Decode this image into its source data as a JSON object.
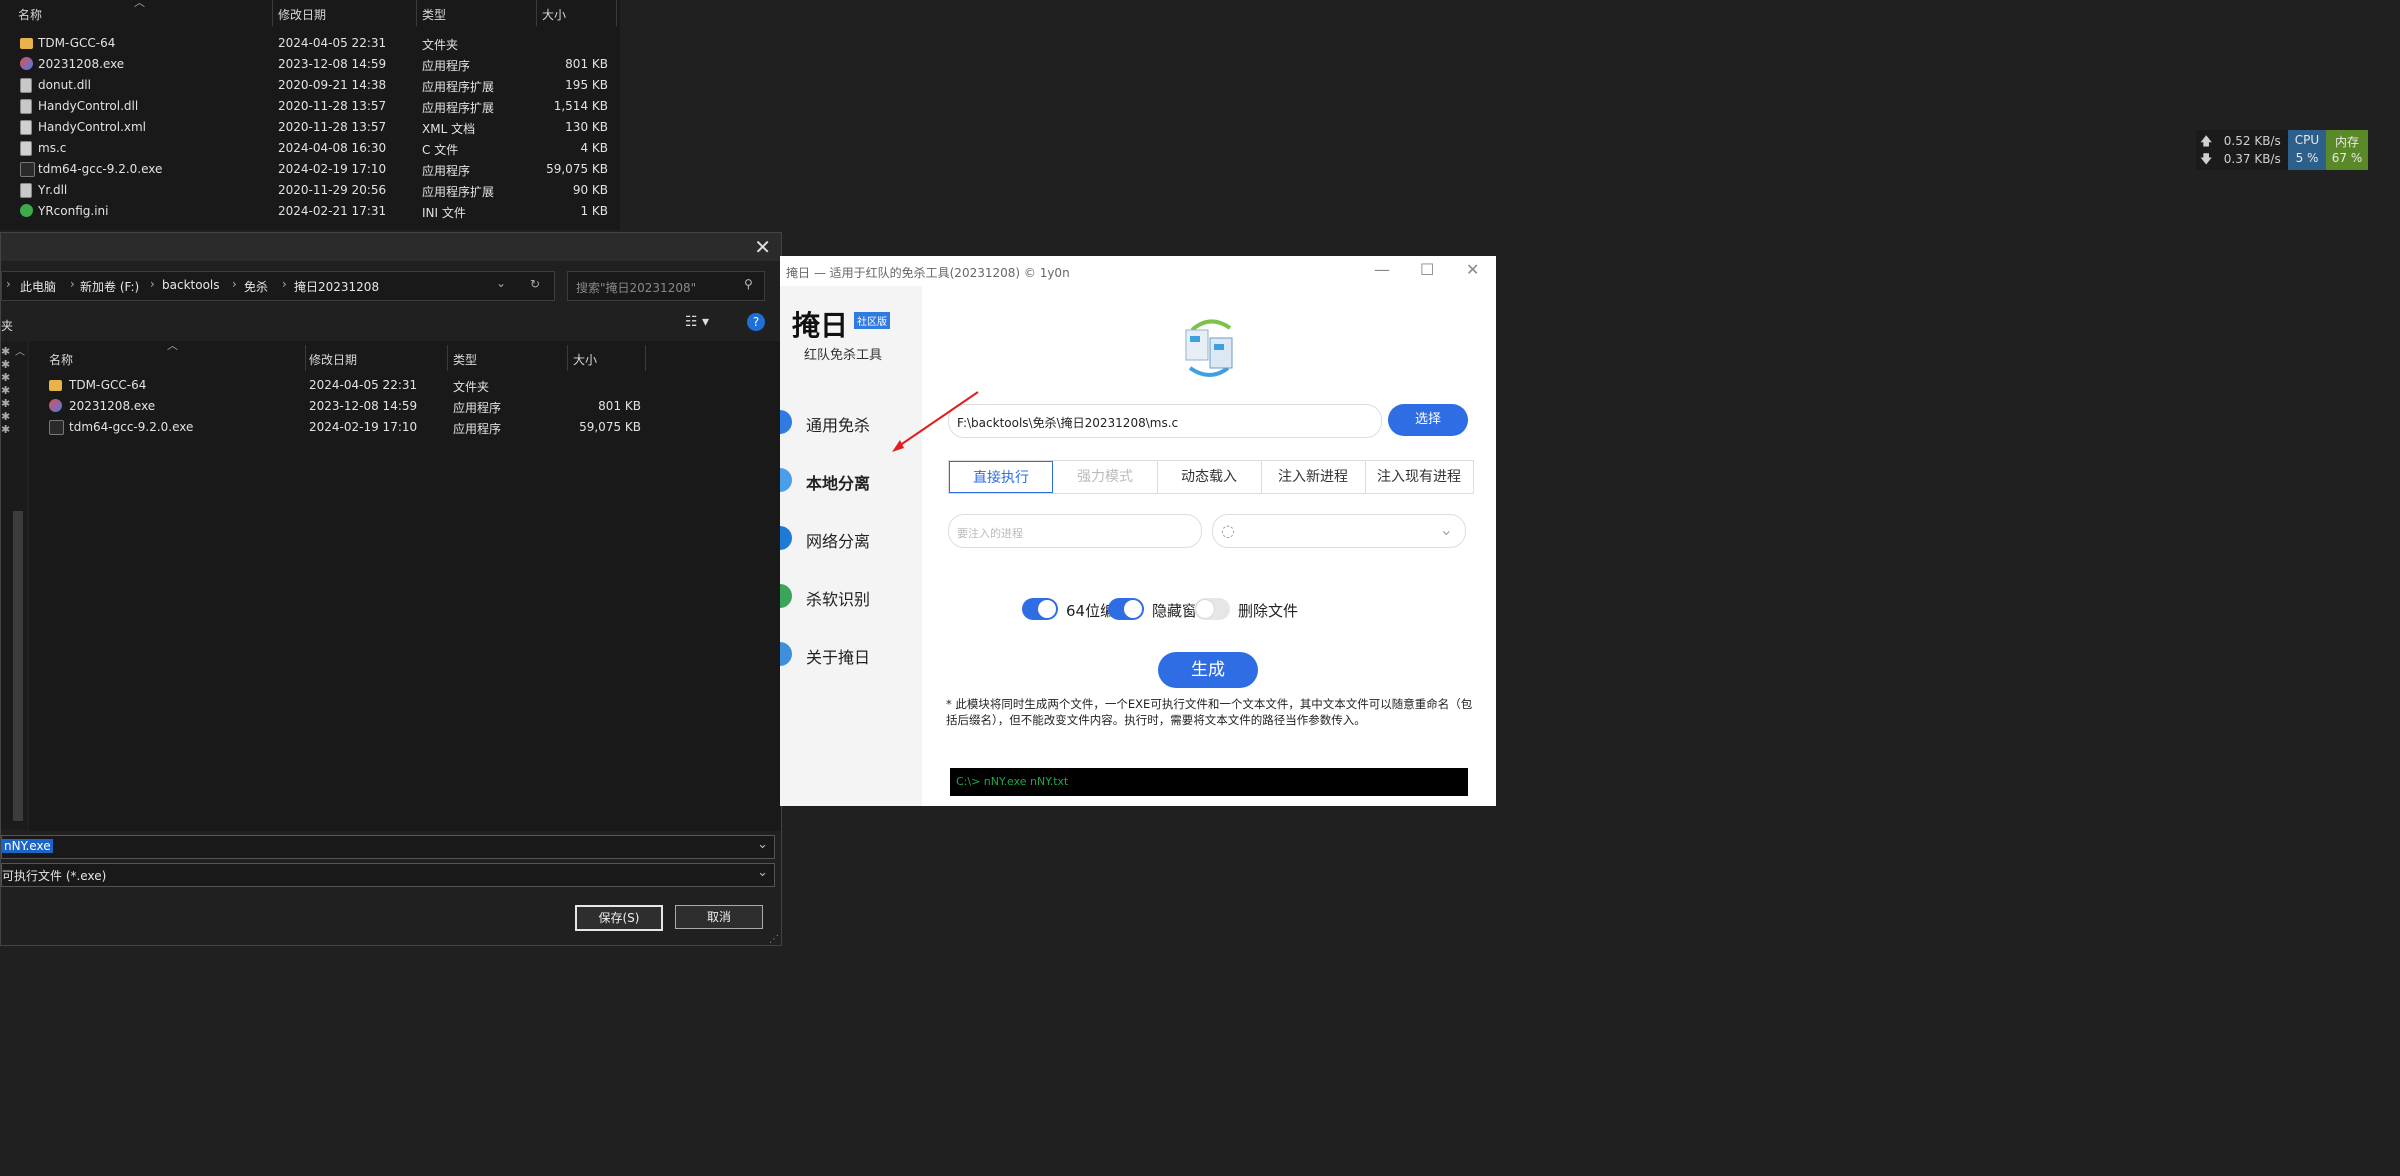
{
  "background_explorer": {
    "columns": [
      "名称",
      "修改日期",
      "类型",
      "大小"
    ],
    "rows": [
      {
        "icon": "folder-icon",
        "name": "TDM-GCC-64",
        "date": "2024-04-05 22:31",
        "type": "文件夹",
        "size": ""
      },
      {
        "icon": "exe-icon",
        "name": "20231208.exe",
        "date": "2023-12-08 14:59",
        "type": "应用程序",
        "size": "801 KB"
      },
      {
        "icon": "dll-icon",
        "name": "donut.dll",
        "date": "2020-09-21 14:38",
        "type": "应用程序扩展",
        "size": "195 KB"
      },
      {
        "icon": "dll-icon",
        "name": "HandyControl.dll",
        "date": "2020-11-28 13:57",
        "type": "应用程序扩展",
        "size": "1,514 KB"
      },
      {
        "icon": "xml-icon",
        "name": "HandyControl.xml",
        "date": "2020-11-28 13:57",
        "type": "XML 文档",
        "size": "130 KB"
      },
      {
        "icon": "c-file-icon",
        "name": "ms.c",
        "date": "2024-04-08 16:30",
        "type": "C 文件",
        "size": "4 KB"
      },
      {
        "icon": "gcc-icon",
        "name": "tdm64-gcc-9.2.0.exe",
        "date": "2024-02-19 17:10",
        "type": "应用程序",
        "size": "59,075 KB"
      },
      {
        "icon": "dll-icon",
        "name": "Yr.dll",
        "date": "2020-11-29 20:56",
        "type": "应用程序扩展",
        "size": "90 KB"
      },
      {
        "icon": "ini-icon",
        "name": "YRconfig.ini",
        "date": "2024-02-21 17:31",
        "type": "INI 文件",
        "size": "1 KB"
      }
    ]
  },
  "save_dialog": {
    "breadcrumb": [
      "此电脑",
      "新加卷 (F:)",
      "backtools",
      "免杀",
      "掩日20231208"
    ],
    "search_placeholder": "搜索\"掩日20231208\"",
    "nav_label": "夹",
    "columns": [
      "名称",
      "修改日期",
      "类型",
      "大小"
    ],
    "rows": [
      {
        "icon": "folder-icon",
        "name": "TDM-GCC-64",
        "date": "2024-04-05 22:31",
        "type": "文件夹",
        "size": ""
      },
      {
        "icon": "exe-icon",
        "name": "20231208.exe",
        "date": "2023-12-08 14:59",
        "type": "应用程序",
        "size": "801 KB"
      },
      {
        "icon": "gcc-icon",
        "name": "tdm64-gcc-9.2.0.exe",
        "date": "2024-02-19 17:10",
        "type": "应用程序",
        "size": "59,075 KB"
      }
    ],
    "filename_value": "nNY.exe",
    "filetype_value": "可执行文件 (*.exe)",
    "save_label": "保存(S)",
    "cancel_label": "取消"
  },
  "app": {
    "title": "掩日 — 适用于红队的免杀工具(20231208) © 1y0n",
    "brand": "掩日",
    "badge": "社区版",
    "brand_sub": "红队免杀工具",
    "nav": [
      {
        "label": "通用免杀",
        "active": false
      },
      {
        "label": "本地分离",
        "active": true
      },
      {
        "label": "网络分离",
        "active": false
      },
      {
        "label": "杀软识别",
        "active": false
      },
      {
        "label": "关于掩日",
        "active": false
      }
    ],
    "path_value": "F:\\backtools\\免杀\\掩日20231208\\ms.c",
    "select_label": "选择",
    "tabs": [
      "直接执行",
      "强力模式",
      "动态载入",
      "注入新进程",
      "注入现有进程"
    ],
    "process_placeholder": "要注入的进程",
    "toggles": [
      {
        "label": "64位编译",
        "on": true
      },
      {
        "label": "隐藏窗口",
        "on": true
      },
      {
        "label": "删除文件",
        "on": false
      }
    ],
    "generate_label": "生成",
    "note": "* 此模块将同时生成两个文件，一个EXE可执行文件和一个文本文件，其中文本文件可以随意重命名（包括后缀名），但不能改变文件内容。执行时，需要将文本文件的路径当作参数传入。",
    "console_text": "C:\\> nNY.exe nNY.txt"
  },
  "net_monitor": {
    "up": "0.52 KB/s",
    "down": "0.37 KB/s",
    "cpu_label": "CPU",
    "cpu_value": "5 %",
    "mem_label": "内存",
    "mem_value": "67 %"
  },
  "colors": {
    "accent": "#2f6de4",
    "console_text": "#1ea84a",
    "selection": "#1d64c8"
  }
}
